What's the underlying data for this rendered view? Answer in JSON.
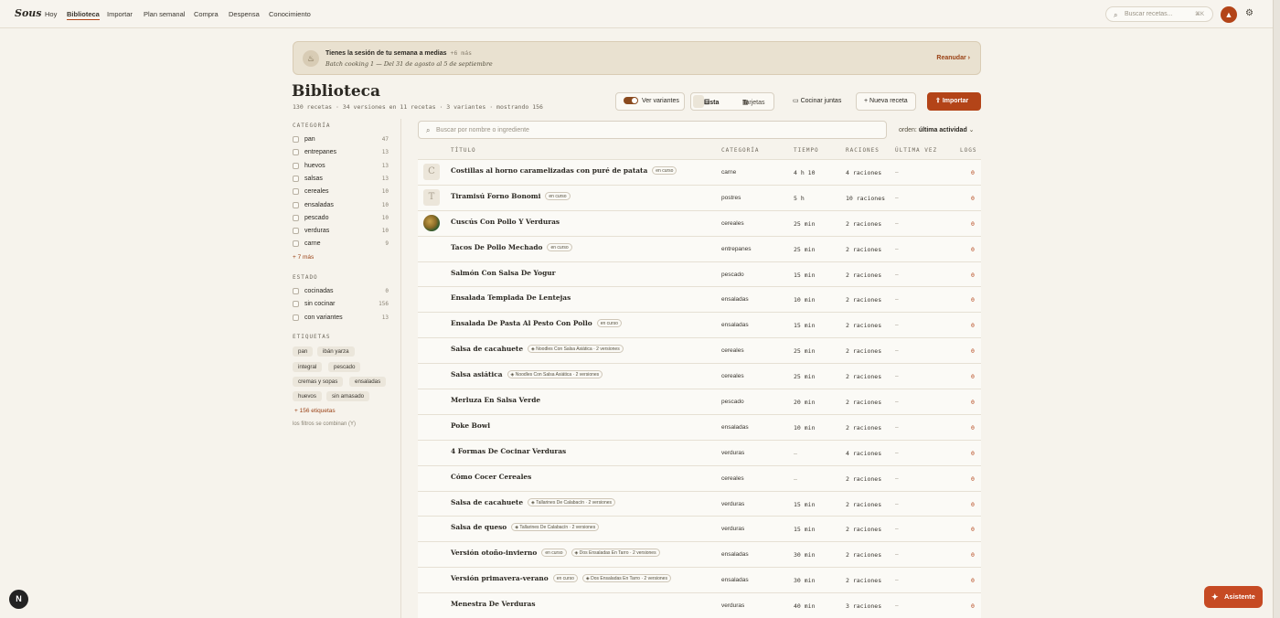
{
  "app": {
    "logo": "Sous",
    "nav": [
      "Hoy",
      "Biblioteca",
      "Importar",
      "Plan semanal",
      "Compra",
      "Despensa",
      "Conocimiento"
    ],
    "active_nav": "Biblioteca",
    "search_placeholder": "Buscar recetas...",
    "search_shortcut": "⌘K",
    "avatar_icon": "flame-icon",
    "accent_color": "#b34418"
  },
  "banner": {
    "title": "Tienes la sesión de tu semana a medias",
    "more": "+6 más",
    "subtitle": "Batch cooking 1 — Del 31 de agosto al 5 de septiembre",
    "action": "Reanudar"
  },
  "header": {
    "title": "Biblioteca",
    "summary": "130 recetas · 34 versiones en 11 recetas · 3 variantes · mostrando 156",
    "show_variants": "Ver variantes",
    "view_list": "Lista",
    "view_cards": "Tarjetas",
    "cook_together": "Cocinar juntas",
    "new_recipe": "Nueva receta",
    "import": "Importar"
  },
  "sidebar": {
    "category_heading": "CATEGORÍA",
    "categories": [
      {
        "label": "pan",
        "count": "47"
      },
      {
        "label": "entrepanes",
        "count": "13"
      },
      {
        "label": "huevos",
        "count": "13"
      },
      {
        "label": "salsas",
        "count": "13"
      },
      {
        "label": "cereales",
        "count": "10"
      },
      {
        "label": "ensaladas",
        "count": "10"
      },
      {
        "label": "pescado",
        "count": "10"
      },
      {
        "label": "verduras",
        "count": "10"
      },
      {
        "label": "carne",
        "count": "9"
      }
    ],
    "categories_more": "+ 7 más",
    "state_heading": "ESTADO",
    "states": [
      {
        "label": "cocinadas",
        "count": "0"
      },
      {
        "label": "sin cocinar",
        "count": "156"
      },
      {
        "label": "con variantes",
        "count": "13"
      }
    ],
    "tags_heading": "ETIQUETAS",
    "tags": [
      "pan",
      "ibán yarza",
      "integral",
      "pescado",
      "cremas y sopas",
      "ensaladas",
      "huevos",
      "sin amasado"
    ],
    "tags_more": "+ 156 etiquetas",
    "note": "los filtros se combinan (Y)"
  },
  "list": {
    "search_placeholder": "Buscar por nombre o ingrediente",
    "order_label": "orden:",
    "order_value": "última actividad",
    "columns": [
      "TÍTULO",
      "CATEGORÍA",
      "TIEMPO",
      "RACIONES",
      "ÚLTIMA VEZ",
      "LOGS"
    ],
    "rows": [
      {
        "thumb": "C",
        "title": "Costillas al horno caramelizadas con puré de patata",
        "badge": "en curso",
        "group": "",
        "category": "carne",
        "time": "4 h 10",
        "servings": "4 raciones",
        "last": "–",
        "logs": "0"
      },
      {
        "thumb": "T",
        "title": "Tiramisú Forno Bonomi",
        "badge": "en curso",
        "group": "",
        "category": "postres",
        "time": "5 h",
        "servings": "10 raciones",
        "last": "–",
        "logs": "0"
      },
      {
        "thumb": "img",
        "title": "Cuscús Con Pollo Y Verduras",
        "badge": "",
        "group": "",
        "category": "cereales",
        "time": "25 min",
        "servings": "2 raciones",
        "last": "–",
        "logs": "0"
      },
      {
        "thumb": "",
        "title": "Tacos De Pollo Mechado",
        "badge": "en curso",
        "group": "",
        "category": "entrepanes",
        "time": "25 min",
        "servings": "2 raciones",
        "last": "–",
        "logs": "0"
      },
      {
        "thumb": "",
        "title": "Salmón Con Salsa De Yogur",
        "badge": "",
        "group": "",
        "category": "pescado",
        "time": "15 min",
        "servings": "2 raciones",
        "last": "–",
        "logs": "0"
      },
      {
        "thumb": "",
        "title": "Ensalada Templada De Lentejas",
        "badge": "",
        "group": "",
        "category": "ensaladas",
        "time": "10 min",
        "servings": "2 raciones",
        "last": "–",
        "logs": "0"
      },
      {
        "thumb": "",
        "title": "Ensalada De Pasta Al Pesto Con Pollo",
        "badge": "en curso",
        "group": "",
        "category": "ensaladas",
        "time": "15 min",
        "servings": "2 raciones",
        "last": "–",
        "logs": "0"
      },
      {
        "thumb": "",
        "title": "Salsa de cacahuete",
        "badge": "",
        "group": "Noodles Con Salsa Asiática · 2 versiones",
        "category": "cereales",
        "time": "25 min",
        "servings": "2 raciones",
        "last": "–",
        "logs": "0"
      },
      {
        "thumb": "",
        "title": "Salsa asiática",
        "badge": "",
        "group": "Noodles Con Salsa Asiática · 2 versiones",
        "category": "cereales",
        "time": "25 min",
        "servings": "2 raciones",
        "last": "–",
        "logs": "0"
      },
      {
        "thumb": "",
        "title": "Merluza En Salsa Verde",
        "badge": "",
        "group": "",
        "category": "pescado",
        "time": "20 min",
        "servings": "2 raciones",
        "last": "–",
        "logs": "0"
      },
      {
        "thumb": "",
        "title": "Poke Bowl",
        "badge": "",
        "group": "",
        "category": "ensaladas",
        "time": "10 min",
        "servings": "2 raciones",
        "last": "–",
        "logs": "0"
      },
      {
        "thumb": "",
        "title": "4 Formas De Cocinar Verduras",
        "badge": "",
        "group": "",
        "category": "verduras",
        "time": "–",
        "servings": "4 raciones",
        "last": "–",
        "logs": "0"
      },
      {
        "thumb": "",
        "title": "Cómo Cocer Cereales",
        "badge": "",
        "group": "",
        "category": "cereales",
        "time": "–",
        "servings": "2 raciones",
        "last": "–",
        "logs": "0"
      },
      {
        "thumb": "",
        "title": "Salsa de cacahuete",
        "badge": "",
        "group": "Tallarines De Calabacín · 2 versiones",
        "category": "verduras",
        "time": "15 min",
        "servings": "2 raciones",
        "last": "–",
        "logs": "0"
      },
      {
        "thumb": "",
        "title": "Salsa de queso",
        "badge": "",
        "group": "Tallarines De Calabacín · 2 versiones",
        "category": "verduras",
        "time": "15 min",
        "servings": "2 raciones",
        "last": "–",
        "logs": "0"
      },
      {
        "thumb": "",
        "title": "Versión otoño-invierno",
        "badge": "en curso",
        "group": "Dos Ensaladas En Tarro · 2 versiones",
        "category": "ensaladas",
        "time": "30 min",
        "servings": "2 raciones",
        "last": "–",
        "logs": "0"
      },
      {
        "thumb": "",
        "title": "Versión primavera-verano",
        "badge": "en curso",
        "group": "Dos Ensaladas En Tarro · 2 versiones",
        "category": "ensaladas",
        "time": "30 min",
        "servings": "2 raciones",
        "last": "–",
        "logs": "0"
      },
      {
        "thumb": "",
        "title": "Menestra De Verduras",
        "badge": "",
        "group": "",
        "category": "verduras",
        "time": "40 min",
        "servings": "3 raciones",
        "last": "–",
        "logs": "0"
      }
    ]
  },
  "floating": {
    "corner_badge": "N",
    "assistant": "Asistente"
  }
}
